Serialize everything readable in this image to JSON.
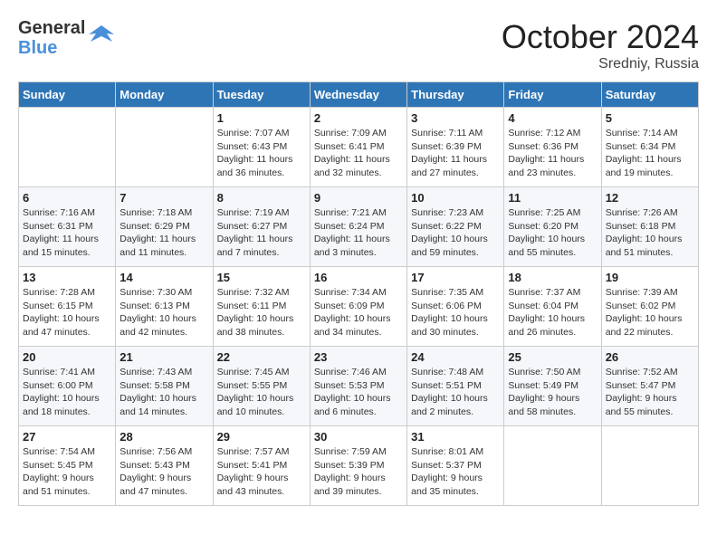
{
  "header": {
    "logo_general": "General",
    "logo_blue": "Blue",
    "month_title": "October 2024",
    "subtitle": "Sredniy, Russia"
  },
  "weekdays": [
    "Sunday",
    "Monday",
    "Tuesday",
    "Wednesday",
    "Thursday",
    "Friday",
    "Saturday"
  ],
  "weeks": [
    [
      {
        "day": "",
        "info": ""
      },
      {
        "day": "",
        "info": ""
      },
      {
        "day": "1",
        "info": "Sunrise: 7:07 AM\nSunset: 6:43 PM\nDaylight: 11 hours and 36 minutes."
      },
      {
        "day": "2",
        "info": "Sunrise: 7:09 AM\nSunset: 6:41 PM\nDaylight: 11 hours and 32 minutes."
      },
      {
        "day": "3",
        "info": "Sunrise: 7:11 AM\nSunset: 6:39 PM\nDaylight: 11 hours and 27 minutes."
      },
      {
        "day": "4",
        "info": "Sunrise: 7:12 AM\nSunset: 6:36 PM\nDaylight: 11 hours and 23 minutes."
      },
      {
        "day": "5",
        "info": "Sunrise: 7:14 AM\nSunset: 6:34 PM\nDaylight: 11 hours and 19 minutes."
      }
    ],
    [
      {
        "day": "6",
        "info": "Sunrise: 7:16 AM\nSunset: 6:31 PM\nDaylight: 11 hours and 15 minutes."
      },
      {
        "day": "7",
        "info": "Sunrise: 7:18 AM\nSunset: 6:29 PM\nDaylight: 11 hours and 11 minutes."
      },
      {
        "day": "8",
        "info": "Sunrise: 7:19 AM\nSunset: 6:27 PM\nDaylight: 11 hours and 7 minutes."
      },
      {
        "day": "9",
        "info": "Sunrise: 7:21 AM\nSunset: 6:24 PM\nDaylight: 11 hours and 3 minutes."
      },
      {
        "day": "10",
        "info": "Sunrise: 7:23 AM\nSunset: 6:22 PM\nDaylight: 10 hours and 59 minutes."
      },
      {
        "day": "11",
        "info": "Sunrise: 7:25 AM\nSunset: 6:20 PM\nDaylight: 10 hours and 55 minutes."
      },
      {
        "day": "12",
        "info": "Sunrise: 7:26 AM\nSunset: 6:18 PM\nDaylight: 10 hours and 51 minutes."
      }
    ],
    [
      {
        "day": "13",
        "info": "Sunrise: 7:28 AM\nSunset: 6:15 PM\nDaylight: 10 hours and 47 minutes."
      },
      {
        "day": "14",
        "info": "Sunrise: 7:30 AM\nSunset: 6:13 PM\nDaylight: 10 hours and 42 minutes."
      },
      {
        "day": "15",
        "info": "Sunrise: 7:32 AM\nSunset: 6:11 PM\nDaylight: 10 hours and 38 minutes."
      },
      {
        "day": "16",
        "info": "Sunrise: 7:34 AM\nSunset: 6:09 PM\nDaylight: 10 hours and 34 minutes."
      },
      {
        "day": "17",
        "info": "Sunrise: 7:35 AM\nSunset: 6:06 PM\nDaylight: 10 hours and 30 minutes."
      },
      {
        "day": "18",
        "info": "Sunrise: 7:37 AM\nSunset: 6:04 PM\nDaylight: 10 hours and 26 minutes."
      },
      {
        "day": "19",
        "info": "Sunrise: 7:39 AM\nSunset: 6:02 PM\nDaylight: 10 hours and 22 minutes."
      }
    ],
    [
      {
        "day": "20",
        "info": "Sunrise: 7:41 AM\nSunset: 6:00 PM\nDaylight: 10 hours and 18 minutes."
      },
      {
        "day": "21",
        "info": "Sunrise: 7:43 AM\nSunset: 5:58 PM\nDaylight: 10 hours and 14 minutes."
      },
      {
        "day": "22",
        "info": "Sunrise: 7:45 AM\nSunset: 5:55 PM\nDaylight: 10 hours and 10 minutes."
      },
      {
        "day": "23",
        "info": "Sunrise: 7:46 AM\nSunset: 5:53 PM\nDaylight: 10 hours and 6 minutes."
      },
      {
        "day": "24",
        "info": "Sunrise: 7:48 AM\nSunset: 5:51 PM\nDaylight: 10 hours and 2 minutes."
      },
      {
        "day": "25",
        "info": "Sunrise: 7:50 AM\nSunset: 5:49 PM\nDaylight: 9 hours and 58 minutes."
      },
      {
        "day": "26",
        "info": "Sunrise: 7:52 AM\nSunset: 5:47 PM\nDaylight: 9 hours and 55 minutes."
      }
    ],
    [
      {
        "day": "27",
        "info": "Sunrise: 7:54 AM\nSunset: 5:45 PM\nDaylight: 9 hours and 51 minutes."
      },
      {
        "day": "28",
        "info": "Sunrise: 7:56 AM\nSunset: 5:43 PM\nDaylight: 9 hours and 47 minutes."
      },
      {
        "day": "29",
        "info": "Sunrise: 7:57 AM\nSunset: 5:41 PM\nDaylight: 9 hours and 43 minutes."
      },
      {
        "day": "30",
        "info": "Sunrise: 7:59 AM\nSunset: 5:39 PM\nDaylight: 9 hours and 39 minutes."
      },
      {
        "day": "31",
        "info": "Sunrise: 8:01 AM\nSunset: 5:37 PM\nDaylight: 9 hours and 35 minutes."
      },
      {
        "day": "",
        "info": ""
      },
      {
        "day": "",
        "info": ""
      }
    ]
  ]
}
